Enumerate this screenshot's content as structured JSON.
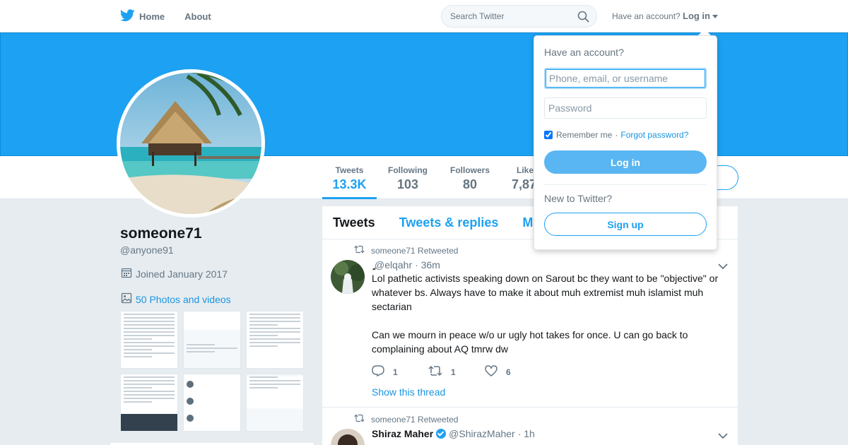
{
  "nav": {
    "home_label": "Home",
    "about_label": "About",
    "search_placeholder": "Search Twitter",
    "have_account_text": "Have an account?",
    "login_label": "Log in"
  },
  "profile": {
    "name": "someone71",
    "handle": "@anyone91",
    "joined": "Joined January 2017",
    "photos_link": "50 Photos and videos"
  },
  "stats": [
    {
      "label": "Tweets",
      "value": "13.3K",
      "active": true
    },
    {
      "label": "Following",
      "value": "103"
    },
    {
      "label": "Followers",
      "value": "80"
    },
    {
      "label": "Likes",
      "value": "7,87"
    }
  ],
  "timeline": {
    "tabs": [
      {
        "label": "Tweets",
        "active": true
      },
      {
        "label": "Tweets & replies"
      },
      {
        "label": "M"
      }
    ],
    "tweets": [
      {
        "retweet_text": "someone71 Retweeted",
        "name": "ٍ",
        "handle": "@elqahr",
        "time": "· 36m",
        "text_1": "Lol pathetic activists speaking down on Sarout bc they want to be \"objective\" or whatever bs. Always have to make it about muh extremist muh islamist muh sectarian",
        "text_2": "Can we mourn in peace w/o ur ugly hot takes for once. U can go back to complaining about AQ tmrw dw",
        "replies": "1",
        "retweets": "1",
        "likes": "6",
        "show_thread": "Show this thread"
      },
      {
        "retweet_text": "someone71 Retweeted",
        "name": "Shiraz Maher",
        "handle": "@ShirazMaher",
        "time": "· 1h"
      }
    ]
  },
  "login_dropdown": {
    "heading": "Have an account?",
    "username_placeholder": "Phone, email, or username",
    "password_placeholder": "Password",
    "remember_label": "Remember me",
    "separator": "·",
    "forgot_label": "Forgot password?",
    "login_button": "Log in",
    "new_text": "New to Twitter?",
    "signup_button": "Sign up"
  },
  "colors": {
    "brand": "#1da1f2",
    "link": "#1b95e0",
    "background": "#e6ecf0"
  },
  "icons": [
    "twitter-bird-icon",
    "search-icon",
    "calendar-icon",
    "photo-icon",
    "retweet-icon",
    "reply-icon",
    "like-icon",
    "chevron-down-icon",
    "verified-icon"
  ]
}
